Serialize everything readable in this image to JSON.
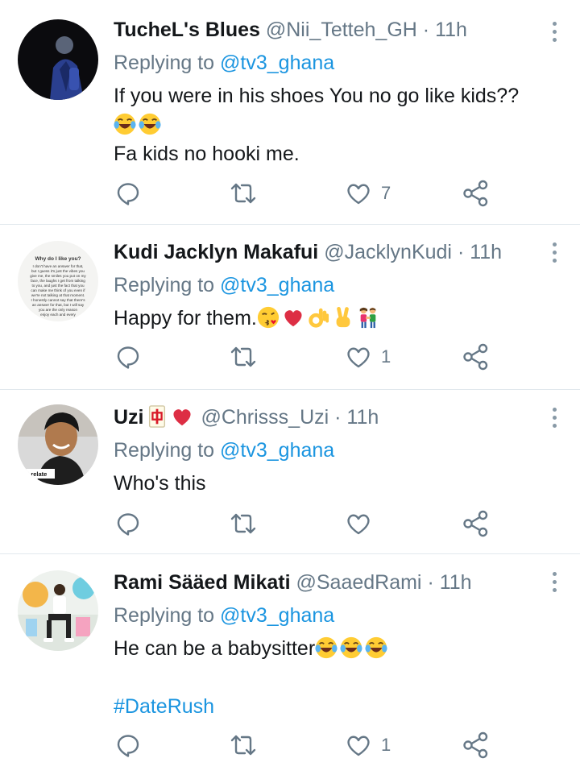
{
  "replies": [
    {
      "display_name": "TucheL's Blues",
      "handle": "@Nii_Tetteh_GH",
      "separator": "·",
      "time": "11h",
      "replying_label": "Replying to",
      "replying_to": "@tv3_ghana",
      "text_line1": "If you were in his shoes You no go like kids??",
      "text_line3": "Fa kids no hooki me.",
      "emojis": [
        "face-with-tears-of-joy",
        "face-with-tears-of-joy"
      ],
      "likes": "7"
    },
    {
      "display_name": "Kudi Jacklyn Makafui",
      "handle": "@JacklynKudi",
      "separator": "·",
      "time": "11h",
      "replying_label": "Replying to",
      "replying_to": "@tv3_ghana",
      "text": "Happy for them.",
      "emojis": [
        "face-blowing-kiss",
        "red-heart",
        "ok-hand",
        "victory-hand",
        "man-and-woman-holding-hands"
      ],
      "avatar_text": [
        "Why do I like you?",
        "I don't have an answer for that,",
        "but I guess it's just the vibes you",
        "give me, the smiles you put on my",
        "face, the laughs I get from talking",
        "to you, and just the fact that you",
        "can make me think of you even if",
        "we're not talking at that moment.",
        "I honestly cannot say that there's",
        "an answer for that, but I will say",
        "you are the only reason",
        "enjoy each and every"
      ],
      "likes": "1"
    },
    {
      "display_name": "Uzi",
      "name_emojis": [
        "mahjong-red-dragon",
        "red-heart"
      ],
      "handle": "@Chrisss_Uzi",
      "separator": "·",
      "time": "11h",
      "replying_label": "Replying to",
      "replying_to": "@tv3_ghana",
      "text": "Who's this",
      "avatar_text": "ent relate",
      "likes": ""
    },
    {
      "display_name": "Rami Sääed Mikati",
      "handle": "@SaaedRami",
      "separator": "·",
      "time": "11h",
      "replying_label": "Replying to",
      "replying_to": "@tv3_ghana",
      "text": "He can be a babysitter",
      "emojis": [
        "face-with-tears-of-joy",
        "face-with-tears-of-joy",
        "face-with-tears-of-joy"
      ],
      "hashtag": "#DateRush",
      "likes": "1"
    }
  ],
  "icons": {
    "reply": "reply-bubble-icon",
    "retweet": "retweet-icon",
    "like": "heart-outline-icon",
    "share": "share-icon",
    "more": "vertical-ellipsis-icon"
  },
  "colors": {
    "link": "#1b95e0",
    "secondary_text": "#657786",
    "icon": "#657786",
    "divider": "#e1e8ed"
  }
}
